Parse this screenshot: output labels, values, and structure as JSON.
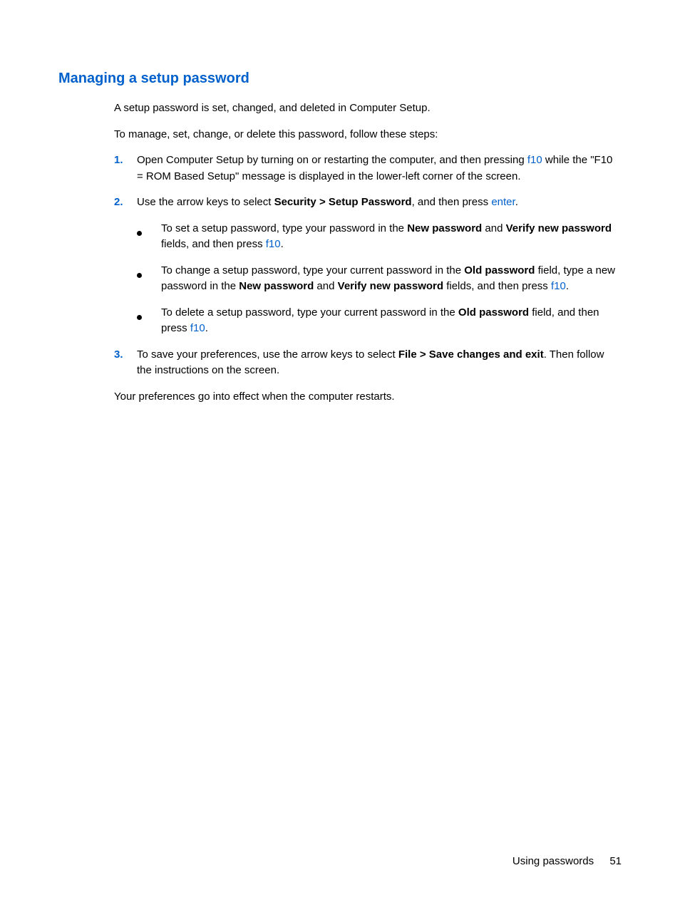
{
  "heading": "Managing a setup password",
  "para1": "A setup password is set, changed, and deleted in Computer Setup.",
  "para2": "To manage, set, change, or delete this password, follow these steps:",
  "step1": {
    "num": "1.",
    "t1": "Open Computer Setup by turning on or restarting the computer, and then pressing ",
    "link1": "f10",
    "t2": " while the \"F10 = ROM Based Setup\" message is displayed in the lower-left corner of the screen."
  },
  "step2": {
    "num": "2.",
    "t1": "Use the arrow keys to select ",
    "b1": "Security > Setup Password",
    "t2": ", and then press ",
    "link1": "enter",
    "t3": "."
  },
  "bullets": {
    "b1": {
      "t1": "To set a setup password, type your password in the ",
      "bold1": "New password",
      "t2": " and ",
      "bold2": "Verify new password",
      "t3": " fields, and then press ",
      "link1": "f10",
      "t4": "."
    },
    "b2": {
      "t1": "To change a setup password, type your current password in the ",
      "bold1": "Old password",
      "t2": " field, type a new password in the ",
      "bold2": "New password",
      "t3": " and ",
      "bold3": "Verify new password",
      "t4": " fields, and then press ",
      "link1": "f10",
      "t5": "."
    },
    "b3": {
      "t1": "To delete a setup password, type your current password in the ",
      "bold1": "Old password",
      "t2": " field, and then press ",
      "link1": "f10",
      "t3": "."
    }
  },
  "step3": {
    "num": "3.",
    "t1": "To save your preferences, use the arrow keys to select ",
    "bold1": "File > Save changes and exit",
    "t2": ". Then follow the instructions on the screen."
  },
  "para3": "Your preferences go into effect when the computer restarts.",
  "footer": {
    "section": "Using passwords",
    "page": "51"
  }
}
